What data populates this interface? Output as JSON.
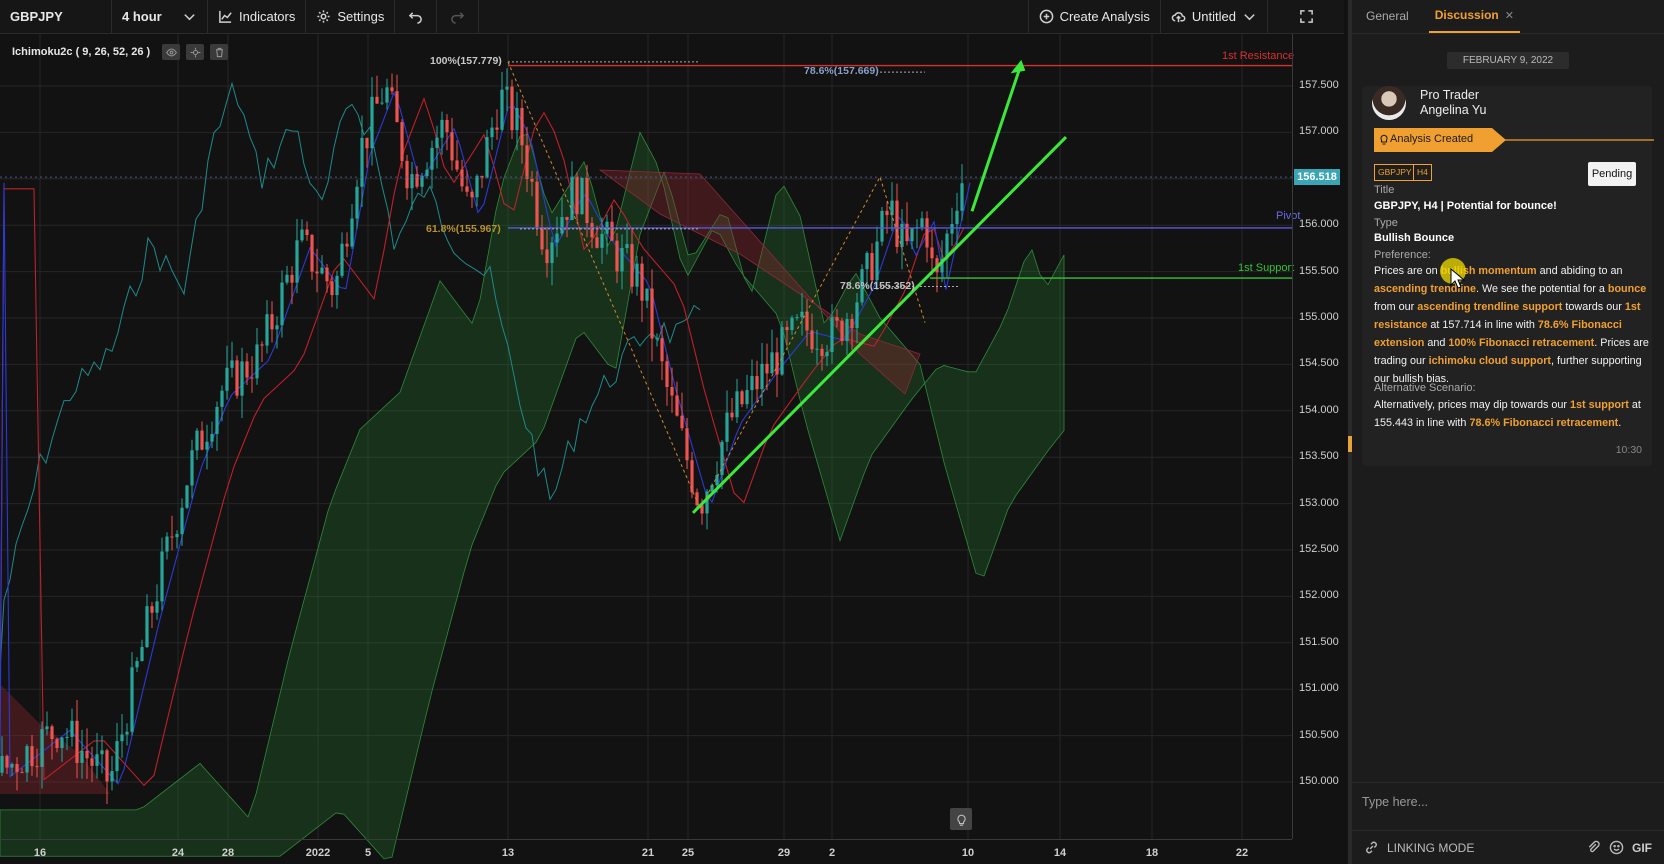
{
  "toolbar": {
    "symbol": "GBPJPY",
    "interval": "4 hour",
    "indicators_label": "Indicators",
    "settings_label": "Settings",
    "create_analysis_label": "Create Analysis",
    "layout_name": "Untitled"
  },
  "chart": {
    "indicator_legend": "Ichimoku2c ( 9, 26, 52, 26 )",
    "current_price": "156.518",
    "price_ticks": [
      "157.500",
      "157.000",
      "156.500",
      "156.000",
      "155.500",
      "155.000",
      "154.500",
      "154.000",
      "153.500",
      "153.000",
      "152.500",
      "152.000",
      "151.500",
      "151.000",
      "150.500",
      "150.000"
    ],
    "time_ticks": [
      "16",
      "24",
      "28",
      "2022",
      "5",
      "13",
      "21",
      "25",
      "29",
      "2",
      "10",
      "14",
      "18",
      "22"
    ],
    "levels": {
      "resistance": "1st Resistance",
      "pivot": "Pivot",
      "support": "1st Support"
    },
    "fib_labels": [
      "100%(157.779)",
      "78.6%(157.669)",
      "61.8%(155.967)",
      "78.6%(155.352)"
    ],
    "colors": {
      "bull": "#26a69a",
      "bear": "#ef5350",
      "resistance": "#d8302f",
      "pivot": "#5a5adb",
      "support": "#36c236",
      "trend": "#3be83b",
      "accent": "#f0a030"
    }
  },
  "sidebar": {
    "tabs": [
      {
        "label": "General"
      },
      {
        "label": "Discussion"
      }
    ],
    "date": "FEBRUARY 9, 2022",
    "message": {
      "author_line1": "Pro Trader",
      "author_line2": "Angelina Yu",
      "status": "Analysis Created",
      "tags": [
        "GBPJPY",
        "H4"
      ],
      "badge": "Pending",
      "title_label": "Title",
      "title": "GBPJPY, H4 | Potential for bounce!",
      "type_label": "Type",
      "type": "Bullish Bounce",
      "preference_label": "Preference:",
      "pref": {
        "t1": "Prices are on ",
        "h1": "bullish momentum",
        "t2": " and abiding to an ",
        "h2": "ascending trendline",
        "t3": ". We see the potential for a ",
        "h3": "bounce",
        "t4": " from our ",
        "h4": "ascending trendline support",
        "t5": " towards our ",
        "h5": "1st resistance",
        "t6": " at 157.714 in line with ",
        "h6": "78.6% Fibonacci extension",
        "t7": " and ",
        "h7": "100% Fibonacci retracement",
        "t8": ". Prices are trading our ",
        "h8": "ichimoku cloud support",
        "t9": ", further supporting our bullish bias."
      },
      "alt_label": "Alternative Scenario:",
      "alt": {
        "t1": "Alternatively, prices may dip towards our ",
        "h1": "1st support",
        "t2": " at 155.443 in line with ",
        "h2": "78.6% Fibonacci retracement",
        "t3": "."
      },
      "time": "10:30"
    },
    "composer_placeholder": "Type here...",
    "linking_mode": "LINKING MODE",
    "gif_label": "GIF"
  }
}
